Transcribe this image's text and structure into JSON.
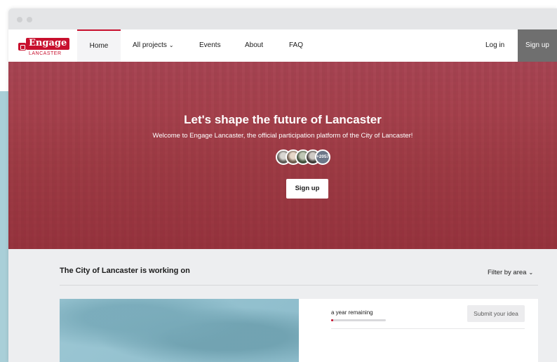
{
  "brand": {
    "logo_word": "Engage",
    "logo_sub": "LANCASTER",
    "accent": "#c8102e"
  },
  "nav": {
    "items": [
      {
        "label": "Home",
        "active": true
      },
      {
        "label": "All projects"
      },
      {
        "label": "Events"
      },
      {
        "label": "About"
      },
      {
        "label": "FAQ"
      }
    ],
    "login": "Log in",
    "signup": "Sign up"
  },
  "hero": {
    "title": "Let's shape the future of Lancaster",
    "subtitle": "Welcome to Engage Lancaster, the official participation platform of the City of Lancaster!",
    "participants_more": "+2057",
    "button": "Sign up"
  },
  "main": {
    "section_title": "The City of Lancaster is working on",
    "filter_label": "Filter by area",
    "card": {
      "remaining": "a year remaining",
      "progress_fraction": 0.04,
      "submit_button": "Submit your idea"
    }
  }
}
